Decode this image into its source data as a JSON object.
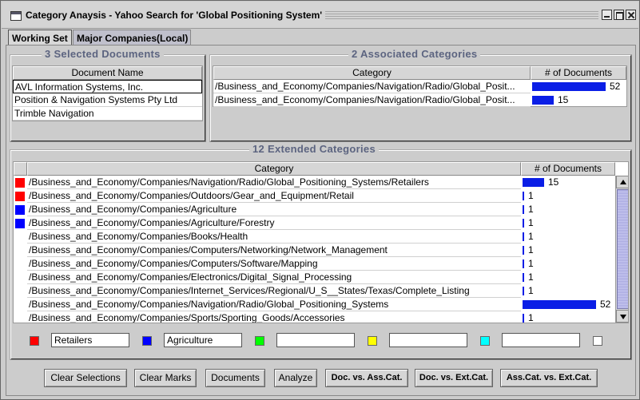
{
  "window": {
    "title": "Category Anaysis - Yahoo Search for 'Global Positioning System'"
  },
  "tabs": [
    {
      "label": "Working Set",
      "active": true
    },
    {
      "label": "Major Companies(Local)",
      "active": false
    }
  ],
  "selected_documents": {
    "title": "3 Selected Documents",
    "column": "Document Name",
    "rows": [
      {
        "name": "AVL Information Systems, Inc.",
        "selected": true
      },
      {
        "name": "Position & Navigation Systems Pty Ltd",
        "selected": false
      },
      {
        "name": "Trimble Navigation",
        "selected": false
      }
    ]
  },
  "associated_categories": {
    "title": "2 Associated Categories",
    "columns": [
      "Category",
      "# of Documents"
    ],
    "max_count": 52,
    "rows": [
      {
        "category": "/Business_and_Economy/Companies/Navigation/Radio/Global_Posit...",
        "count": 52
      },
      {
        "category": "/Business_and_Economy/Companies/Navigation/Radio/Global_Posit...",
        "count": 15
      }
    ]
  },
  "extended_categories": {
    "title": "12 Extended Categories",
    "columns": [
      "Category",
      "# of Documents"
    ],
    "max_count": 52,
    "rows": [
      {
        "category": "/Business_and_Economy/Companies/Navigation/Radio/Global_Positioning_Systems/Retailers",
        "count": 15,
        "mark": "#ff0000"
      },
      {
        "category": "/Business_and_Economy/Companies/Outdoors/Gear_and_Equipment/Retail",
        "count": 1,
        "mark": "#ff0000"
      },
      {
        "category": "/Business_and_Economy/Companies/Agriculture",
        "count": 1,
        "mark": "#0000ff"
      },
      {
        "category": "/Business_and_Economy/Companies/Agriculture/Forestry",
        "count": 1,
        "mark": "#0000ff"
      },
      {
        "category": "/Business_and_Economy/Companies/Books/Health",
        "count": 1,
        "mark": "#ffffff"
      },
      {
        "category": "/Business_and_Economy/Companies/Computers/Networking/Network_Management",
        "count": 1,
        "mark": "#ffffff"
      },
      {
        "category": "/Business_and_Economy/Companies/Computers/Software/Mapping",
        "count": 1,
        "mark": "#ffffff"
      },
      {
        "category": "/Business_and_Economy/Companies/Electronics/Digital_Signal_Processing",
        "count": 1,
        "mark": "#ffffff"
      },
      {
        "category": "/Business_and_Economy/Companies/Internet_Services/Regional/U_S__States/Texas/Complete_Listing",
        "count": 1,
        "mark": "#ffffff"
      },
      {
        "category": "/Business_and_Economy/Companies/Navigation/Radio/Global_Positioning_Systems",
        "count": 52,
        "mark": "#ffffff"
      },
      {
        "category": "/Business_and_Economy/Companies/Sports/Sporting_Goods/Accessories",
        "count": 1,
        "mark": "#ffffff"
      }
    ]
  },
  "marks": [
    {
      "color": "#ff0000",
      "label": "Retailers"
    },
    {
      "color": "#0000ff",
      "label": "Agriculture"
    },
    {
      "color": "#00ff00",
      "label": ""
    },
    {
      "color": "#ffff00",
      "label": ""
    },
    {
      "color": "#00ffff",
      "label": ""
    },
    {
      "color": "#ffffff",
      "label": ""
    }
  ],
  "buttons": {
    "clear_selections": "Clear Selections",
    "clear_marks": "Clear Marks",
    "documents": "Documents",
    "analyze": "Analyze",
    "doc_vs_asscat": "Doc. vs. Ass.Cat.",
    "doc_vs_extcat": "Doc. vs. Ext.Cat.",
    "asscat_vs_extcat": "Ass.Cat. vs. Ext.Cat."
  },
  "colors": {
    "bar": "#0a1ee6",
    "group_title": "#5c6480"
  }
}
